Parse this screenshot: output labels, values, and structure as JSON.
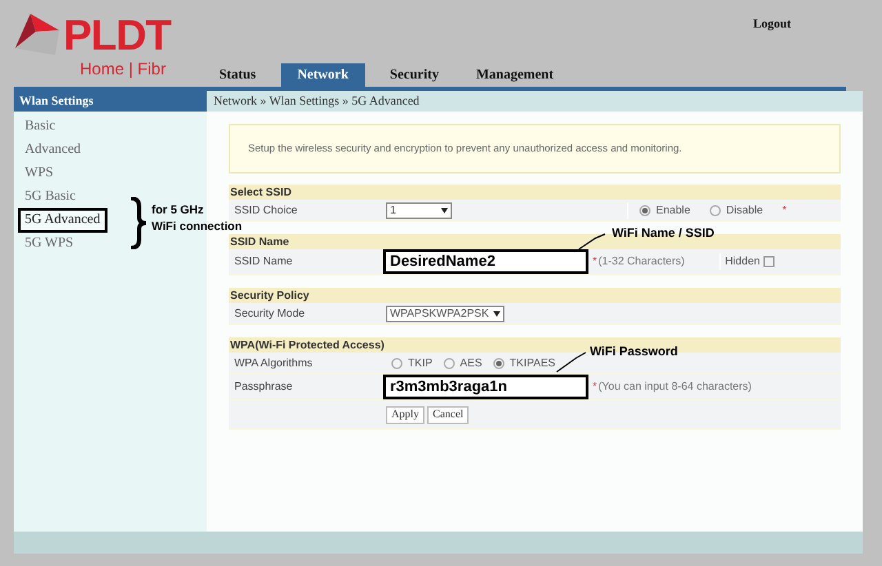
{
  "logo": {
    "brand": "PLDT",
    "tagline": "Home | Fibr"
  },
  "logout": "Logout",
  "tabs": [
    {
      "label": "Status",
      "selected": false
    },
    {
      "label": "Network",
      "selected": true
    },
    {
      "label": "Security",
      "selected": false
    },
    {
      "label": "Management",
      "selected": false
    }
  ],
  "sidebar": {
    "title": "Wlan Settings",
    "items": [
      {
        "label": "Basic",
        "selected": false
      },
      {
        "label": "Advanced",
        "selected": false
      },
      {
        "label": "WPS",
        "selected": false
      },
      {
        "label": "5G Basic",
        "selected": false
      },
      {
        "label": "5G Advanced",
        "selected": true
      },
      {
        "label": "5G WPS",
        "selected": false
      }
    ]
  },
  "breadcrumb": "Network » Wlan Settings » 5G Advanced",
  "intro": "Setup the wireless security and encryption to prevent any unauthorized access and monitoring.",
  "sections": [
    {
      "title": "Select SSID",
      "rows": [
        {
          "kind": "choice",
          "label": "SSID Choice",
          "value": "1",
          "required": "*",
          "options": [
            {
              "label": "Enable",
              "selected": true
            },
            {
              "label": "Disable",
              "selected": false
            }
          ]
        }
      ]
    },
    {
      "title": "SSID Name",
      "rows": [
        {
          "kind": "text",
          "label": "SSID Name",
          "value": "DesiredName2",
          "highlighted": true,
          "required": "*",
          "hint": "(1-32 Characters)",
          "checkbox": {
            "label": "Hidden",
            "checked": false
          }
        }
      ]
    },
    {
      "title": "Security Policy",
      "rows": [
        {
          "kind": "select",
          "label": "Security Mode",
          "value": "WPAPSKWPA2PSK"
        }
      ]
    },
    {
      "title": "WPA(Wi-Fi Protected Access)",
      "rows": [
        {
          "kind": "radios",
          "label": "WPA Algorithms",
          "options": [
            {
              "label": "TKIP",
              "selected": false
            },
            {
              "label": "AES",
              "selected": false
            },
            {
              "label": "TKIPAES",
              "selected": true
            }
          ]
        },
        {
          "kind": "text",
          "label": "Passphrase",
          "value": "r3m3mb3raga1n",
          "highlighted": true,
          "required": "*",
          "hint": "(You can input 8-64 characters)"
        },
        {
          "kind": "buttons",
          "buttons": [
            "Apply",
            "Cancel"
          ]
        }
      ]
    }
  ],
  "annotations": [
    {
      "kind": "brace",
      "lines": [
        "for 5 GHz",
        "WiFi connection"
      ]
    },
    {
      "kind": "leader",
      "text": "WiFi Name / SSID"
    },
    {
      "kind": "leader",
      "text": "WiFi Password"
    }
  ]
}
